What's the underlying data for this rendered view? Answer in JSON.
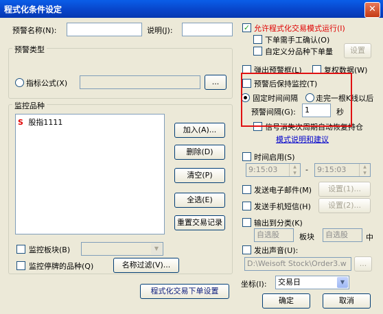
{
  "window": {
    "title": "程式化条件设定",
    "close_glyph": "✕"
  },
  "left": {
    "alert_name_label": "预警名称(N):",
    "alert_name_value": "",
    "desc_label": "说明(J):",
    "desc_value": "",
    "alert_type_group": "预警类型",
    "indicator_formula_label": "指标公式(X)",
    "formula_value": "",
    "formula_browse": "...",
    "monitor_group": "监控品种",
    "monitor_items": [
      {
        "mark": "S",
        "name": "股指1111"
      }
    ],
    "add_button": "加入(A)...",
    "delete_button": "删除(D)",
    "clear_button": "清空(P)",
    "select_all_button": "全选(E)",
    "reset_trade_button": "重置交易记录",
    "monitor_sector_label": "监控板块(B)",
    "monitor_sector_value": "",
    "monitor_suspended_label": "监控停牌的品种(Q)",
    "name_filter_button": "名称过滤(V)...",
    "trade_settings_button": "程式化交易下单设置"
  },
  "right": {
    "allow_trading_label": "允许程式化交易模式运行(I)",
    "manual_confirm_label": "下单需手工确认(O)",
    "custom_qty_label": "自定义分品种下单量",
    "settings_button": "设置",
    "popup_alert_label": "弹出预警框(L)",
    "replay_data_label": "复权数据(W)",
    "keep_monitoring_label": "预警后保持监控(T)",
    "fixed_interval_label": "固定时间间隔",
    "bar_end_label": "走完一根K线以后",
    "alert_interval_label": "预警间隔(G):",
    "alert_interval_value": "1",
    "seconds_unit": "秒",
    "signal_vanish_label": "信号消失次周期自动恢复持仓",
    "mode_help_link": "模式说明和建议",
    "time_enable_label": "时间启用(S)",
    "time_start": "9:15:03",
    "time_sep": "-",
    "time_end": "9:15:03",
    "send_email_label": "发送电子邮件(M)",
    "email_settings_button": "设置(1)...",
    "send_sms_label": "发送手机短信(H)",
    "sms_settings_button": "设置(2)...",
    "output_category_label": "输出到分类(K)",
    "category_value": "自选股",
    "sector_label": "板块",
    "sector_value": "自选股",
    "sector_suffix": "中",
    "play_sound_label": "发出声音(U):",
    "sound_path": "D:\\Weisoft Stock\\Order3.w",
    "sound_browse": "...",
    "axis_label": "坐标(I):",
    "axis_value": "交易日",
    "ok_button": "确定",
    "cancel_button": "取消"
  }
}
